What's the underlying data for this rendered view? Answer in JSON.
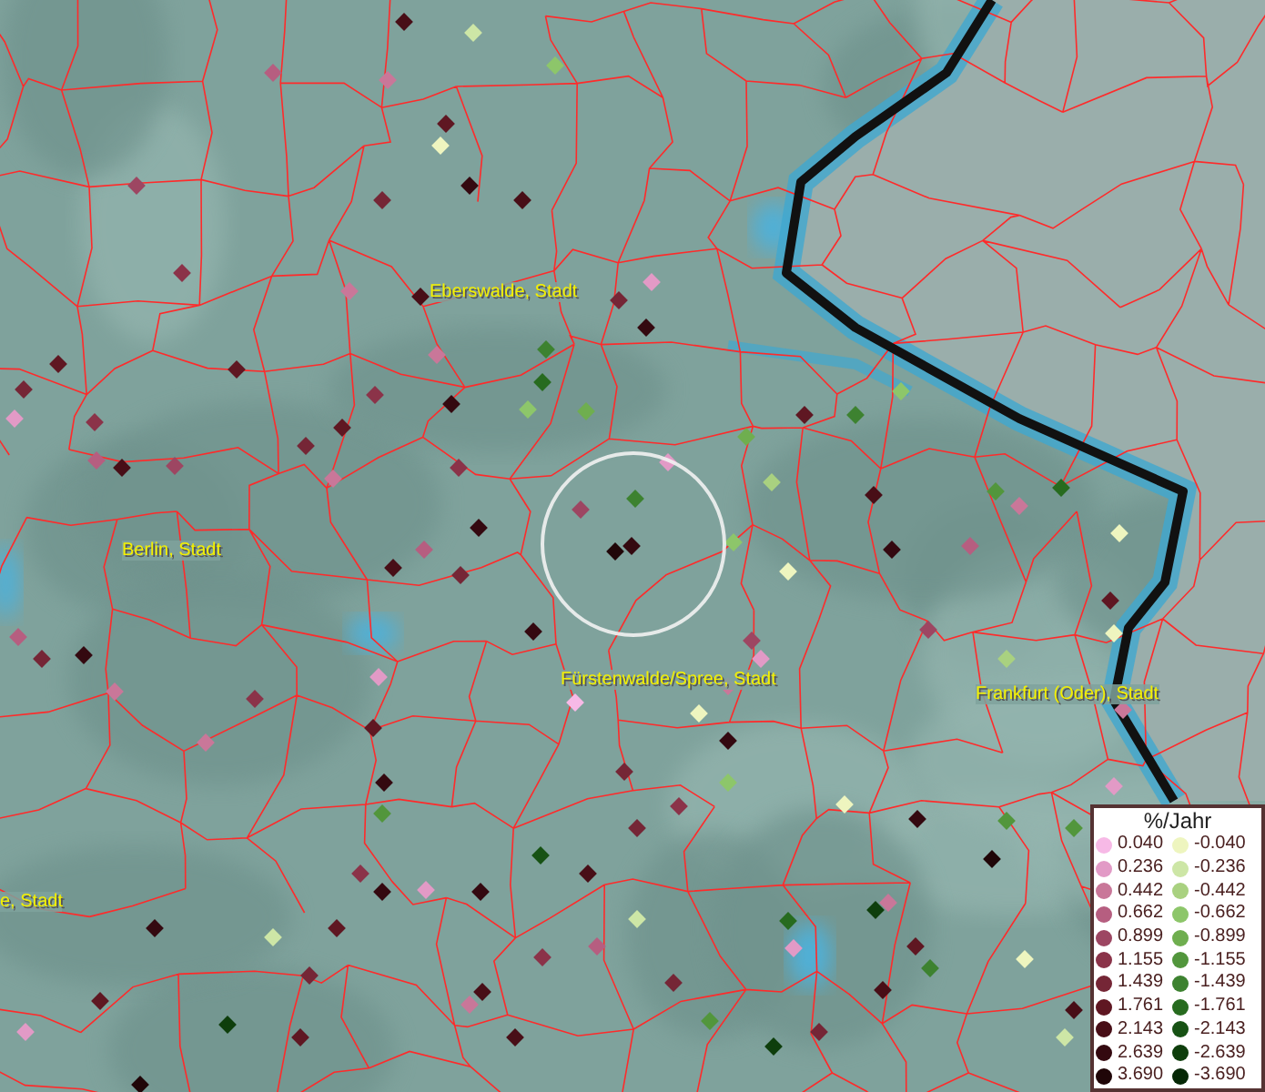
{
  "map": {
    "places": [
      {
        "name": "Eberswalde, Stadt"
      },
      {
        "name": "Berlin, Stadt"
      },
      {
        "name": "Fürstenwalde/Spree, Stadt"
      },
      {
        "name": "Frankfurt (Oder), Stadt"
      },
      {
        "name": "e, Stadt"
      }
    ]
  },
  "legend": {
    "title": "%/Jahr",
    "positive": [
      {
        "label": "0.040",
        "color": "#f7b9e6"
      },
      {
        "label": "0.236",
        "color": "#e29ac6"
      },
      {
        "label": "0.442",
        "color": "#c97799"
      },
      {
        "label": "0.662",
        "color": "#b65e80"
      },
      {
        "label": "0.899",
        "color": "#9d4662"
      },
      {
        "label": "1.155",
        "color": "#8b3349"
      },
      {
        "label": "1.439",
        "color": "#752636"
      },
      {
        "label": "1.761",
        "color": "#5f1722"
      },
      {
        "label": "2.143",
        "color": "#480e17"
      },
      {
        "label": "2.639",
        "color": "#340910"
      },
      {
        "label": "3.690",
        "color": "#200608"
      }
    ],
    "negative": [
      {
        "label": "-0.040",
        "color": "#eef5bf"
      },
      {
        "label": "-0.236",
        "color": "#cde6a6"
      },
      {
        "label": "-0.442",
        "color": "#a9d180"
      },
      {
        "label": "-0.662",
        "color": "#8dc66a"
      },
      {
        "label": "-0.899",
        "color": "#6fae4f"
      },
      {
        "label": "-1.155",
        "color": "#52963c"
      },
      {
        "label": "-1.439",
        "color": "#3d8230"
      },
      {
        "label": "-1.761",
        "color": "#276b1f"
      },
      {
        "label": "-2.143",
        "color": "#175214"
      },
      {
        "label": "-2.639",
        "color": "#0e3e0c"
      },
      {
        "label": "-3.690",
        "color": "#062806"
      }
    ]
  }
}
